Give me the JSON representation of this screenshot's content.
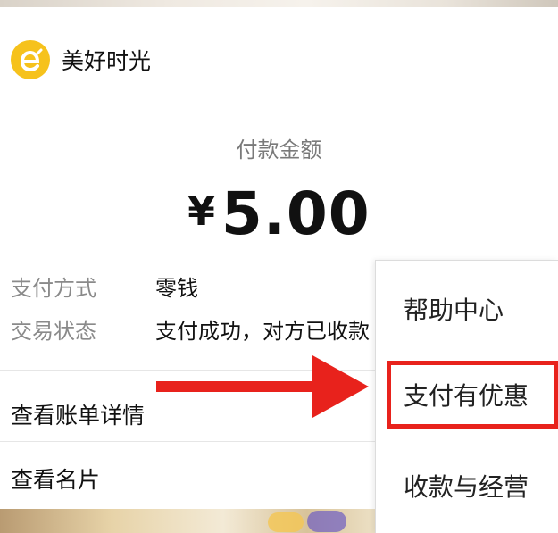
{
  "merchant": {
    "name": "美好时光",
    "logo_icon": "orange-e-logo-icon"
  },
  "payment": {
    "label": "付款金额",
    "currency": "¥",
    "amount": "5.00"
  },
  "details": [
    {
      "key": "支付方式",
      "value": "零钱"
    },
    {
      "key": "交易状态",
      "value": "支付成功，对方已收款"
    }
  ],
  "links": {
    "bill_details": "查看账单详情",
    "business_card": "查看名片"
  },
  "menu": {
    "items": [
      {
        "label": "帮助中心",
        "highlighted": false
      },
      {
        "label": "支付有优惠",
        "highlighted": true
      },
      {
        "label": "收款与经营",
        "highlighted": false
      }
    ]
  },
  "colors": {
    "accent_red": "#e8221c",
    "logo_yellow": "#f6c21c"
  }
}
